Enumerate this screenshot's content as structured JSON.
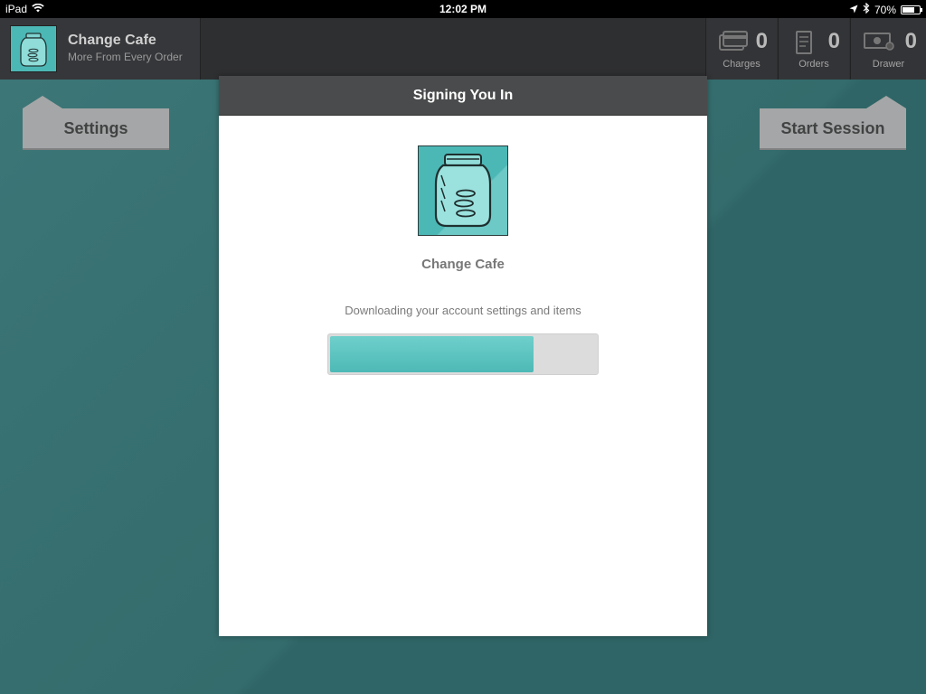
{
  "status_bar": {
    "device": "iPad",
    "time": "12:02 PM",
    "battery": "70%",
    "battery_level": 0.7,
    "icons": [
      "wifi-icon",
      "location-arrow-icon",
      "bluetooth-icon",
      "battery-icon"
    ]
  },
  "header": {
    "app_name": "Change Cafe",
    "tagline": "More From Every Order",
    "logo_icon": "mason-jar-coins-icon",
    "stats": [
      {
        "label": "Charges",
        "value": "0",
        "icon": "credit-card-icon"
      },
      {
        "label": "Orders",
        "value": "0",
        "icon": "receipt-icon"
      },
      {
        "label": "Drawer",
        "value": "0",
        "icon": "cash-icon"
      }
    ]
  },
  "tabs": {
    "settings_label": "Settings",
    "start_session_label": "Start Session"
  },
  "modal": {
    "title": "Signing You In",
    "business_name": "Change Cafe",
    "message": "Downloading your account settings and items",
    "progress": 0.76
  },
  "colors": {
    "background": "#33696a",
    "accent": "#4cb8b6",
    "header": "#2e2f31",
    "modal_header": "#4a4b4c",
    "tab_button": "#a5a6a7"
  }
}
